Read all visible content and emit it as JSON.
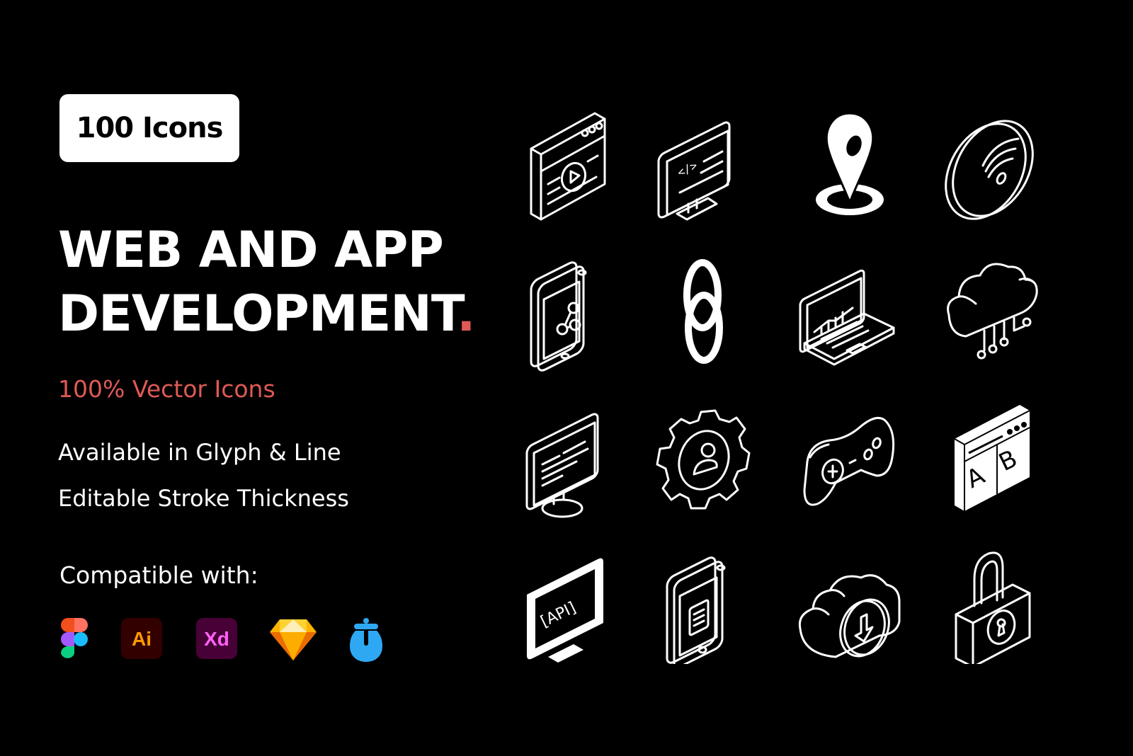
{
  "badge": {
    "label": "100 Icons"
  },
  "title": {
    "line1": "WEB AND APP",
    "line2": "DEVELOPMENT",
    "accent_dot": ".",
    "accent_color": "#e05a55"
  },
  "subtitle": "100% Vector Icons",
  "features": [
    "Available in Glyph & Line",
    "Editable Stroke Thickness"
  ],
  "compatible": {
    "label": "Compatible with:",
    "apps": [
      {
        "name": "Figma",
        "icon": "figma-icon"
      },
      {
        "name": "Adobe Illustrator",
        "icon": "illustrator-icon",
        "text": "Ai"
      },
      {
        "name": "Adobe XD",
        "icon": "xd-icon",
        "text": "Xd"
      },
      {
        "name": "Sketch",
        "icon": "sketch-icon"
      },
      {
        "name": "Iconjar",
        "icon": "iconjar-icon"
      }
    ]
  },
  "icons": [
    "video-browser-icon",
    "code-monitor-icon",
    "location-pin-icon",
    "wifi-disc-icon",
    "share-smartphone-icon",
    "chain-link-icon",
    "analytics-laptop-icon",
    "cloud-network-icon",
    "text-monitor-icon",
    "user-settings-gear-icon",
    "gamepad-icon",
    "ab-testing-browser-icon",
    "api-monitor-icon",
    "clipboard-smartphone-icon",
    "cloud-download-icon",
    "padlock-icon"
  ]
}
